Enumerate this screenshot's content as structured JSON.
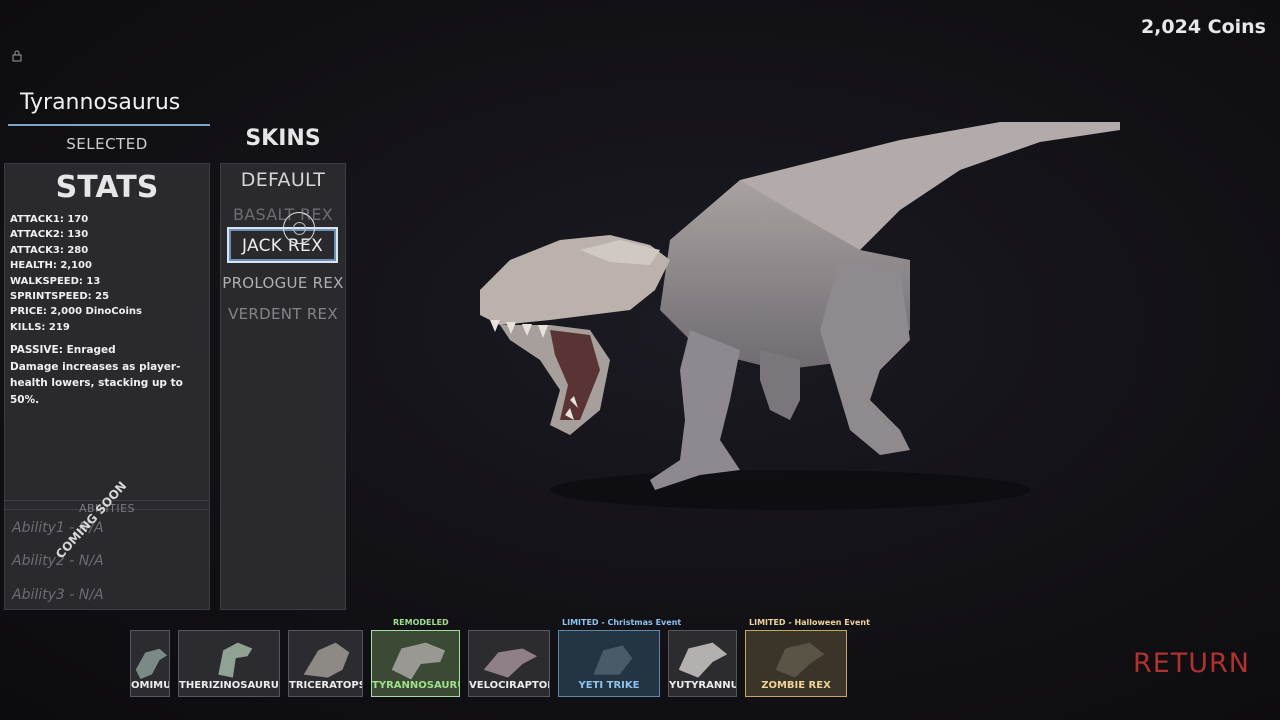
{
  "header": {
    "coins": "2,024 Coins"
  },
  "dino": {
    "name": "Tyrannosaurus",
    "status": "SELECTED"
  },
  "stats": {
    "title": "STATS",
    "lines": [
      "ATTACK1: 170",
      "ATTACK2: 130",
      "ATTACK3: 280",
      "HEALTH: 2,100",
      "WALKSPEED: 13",
      "SPRINTSPEED: 25",
      "PRICE: 2,000 DinoCoins",
      "KILLS: 219"
    ],
    "passive_title": "PASSIVE: Enraged",
    "passive_desc": "Damage increases as player-health lowers, stacking up to 50%.",
    "abilities_title": "ABILITIES",
    "abilities": [
      "Ability1 - N/A",
      "Ability2 - N/A",
      "Ability3 - N/A"
    ],
    "coming_soon": "COMING SOON"
  },
  "skins": {
    "title": "SKINS",
    "items": [
      "DEFAULT",
      "BASALT REX",
      "JACK REX",
      "PROLOGUE REX",
      "VERDENT REX"
    ],
    "highlighted": "JACK REX"
  },
  "roster": [
    {
      "label": "OMIMUS",
      "tag": ""
    },
    {
      "label": "THERIZINOSAURUS",
      "tag": ""
    },
    {
      "label": "TRICERATOPS",
      "tag": ""
    },
    {
      "label": "TYRANNOSAURUS",
      "tag": "REMODELED",
      "selected": true
    },
    {
      "label": "VELOCIRAPTOR",
      "tag": ""
    },
    {
      "label": "YETI TRIKE",
      "tag": "LIMITED - Christmas Event"
    },
    {
      "label": "YUTYRANNUS",
      "tag": ""
    },
    {
      "label": "ZOMBIE REX",
      "tag": "LIMITED - Halloween Event"
    }
  ],
  "footer": {
    "return": "RETURN"
  },
  "colors": {
    "accent_blue": "#7fa6c8",
    "selected_green": "#9fe08d",
    "return_red": "#b0322c",
    "yeti_blue": "#8dc3ee",
    "zombie_gold": "#efd39a"
  }
}
